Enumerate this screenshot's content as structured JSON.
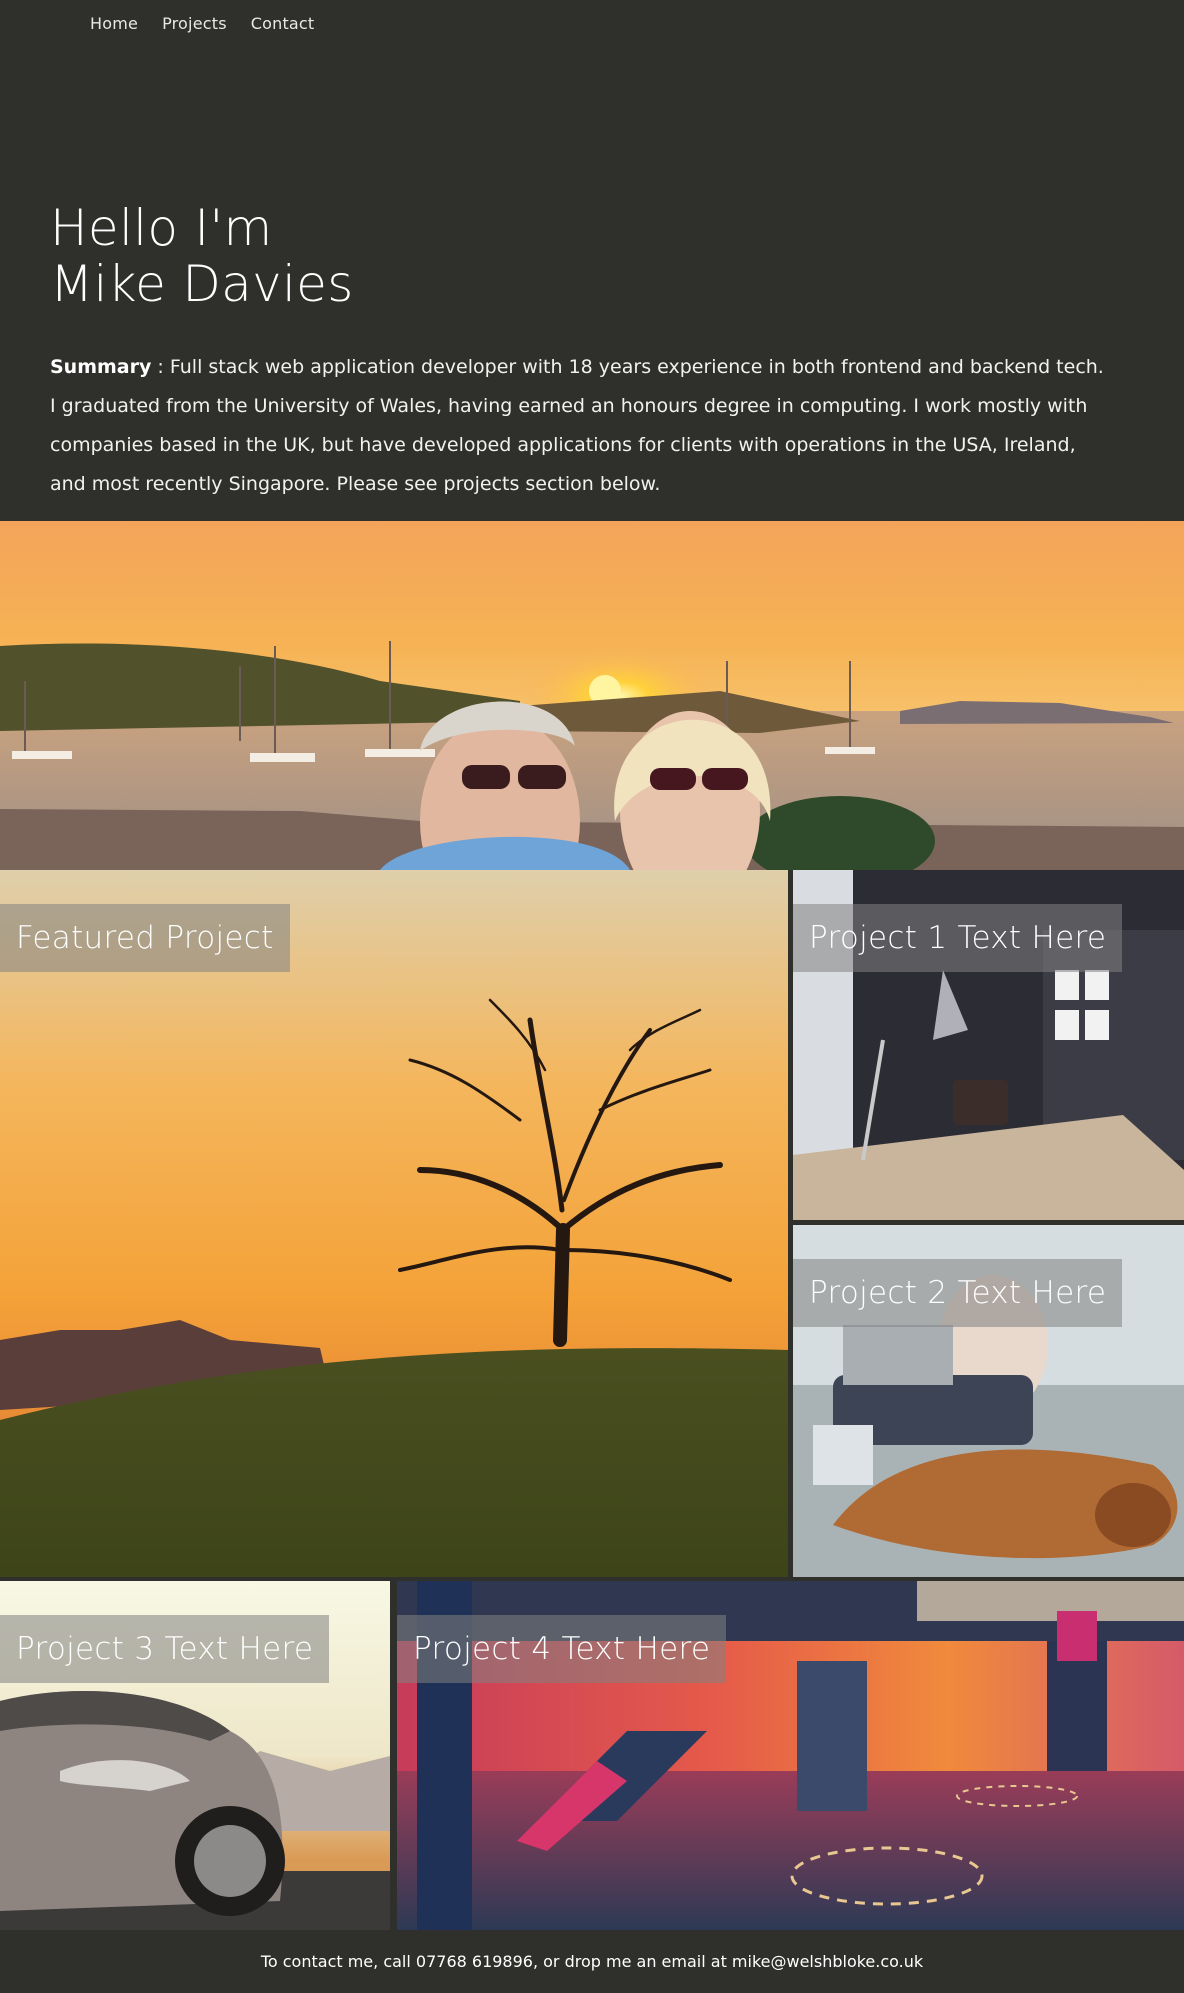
{
  "nav": {
    "items": [
      {
        "label": "Home"
      },
      {
        "label": "Projects"
      },
      {
        "label": "Contact"
      }
    ]
  },
  "hero": {
    "greeting": "Hello I'm",
    "name": "Mike Davies",
    "summary_label": "Summary",
    "summary_text": " : Full stack web application developer with 18 years experience in both frontend and backend tech. I graduated from the University of Wales, having earned an honours degree in computing. I work mostly with companies based in the UK, but have developed applications for clients with operations in the USA, Ireland, and most recently Singapore. Please see projects section below."
  },
  "projects": {
    "featured": {
      "label": "Featured Project"
    },
    "p1": {
      "label": "Project 1 Text Here"
    },
    "p2": {
      "label": "Project 2 Text Here"
    },
    "p3": {
      "label": "Project 3 Text Here"
    },
    "p4": {
      "label": "Project 4 Text Here"
    }
  },
  "footer": {
    "text": "To contact me, call 07768 619896, or drop me an email at mike@welshbloke.co.uk"
  },
  "colors": {
    "background": "#2f302c",
    "label_bg": "#828282"
  }
}
